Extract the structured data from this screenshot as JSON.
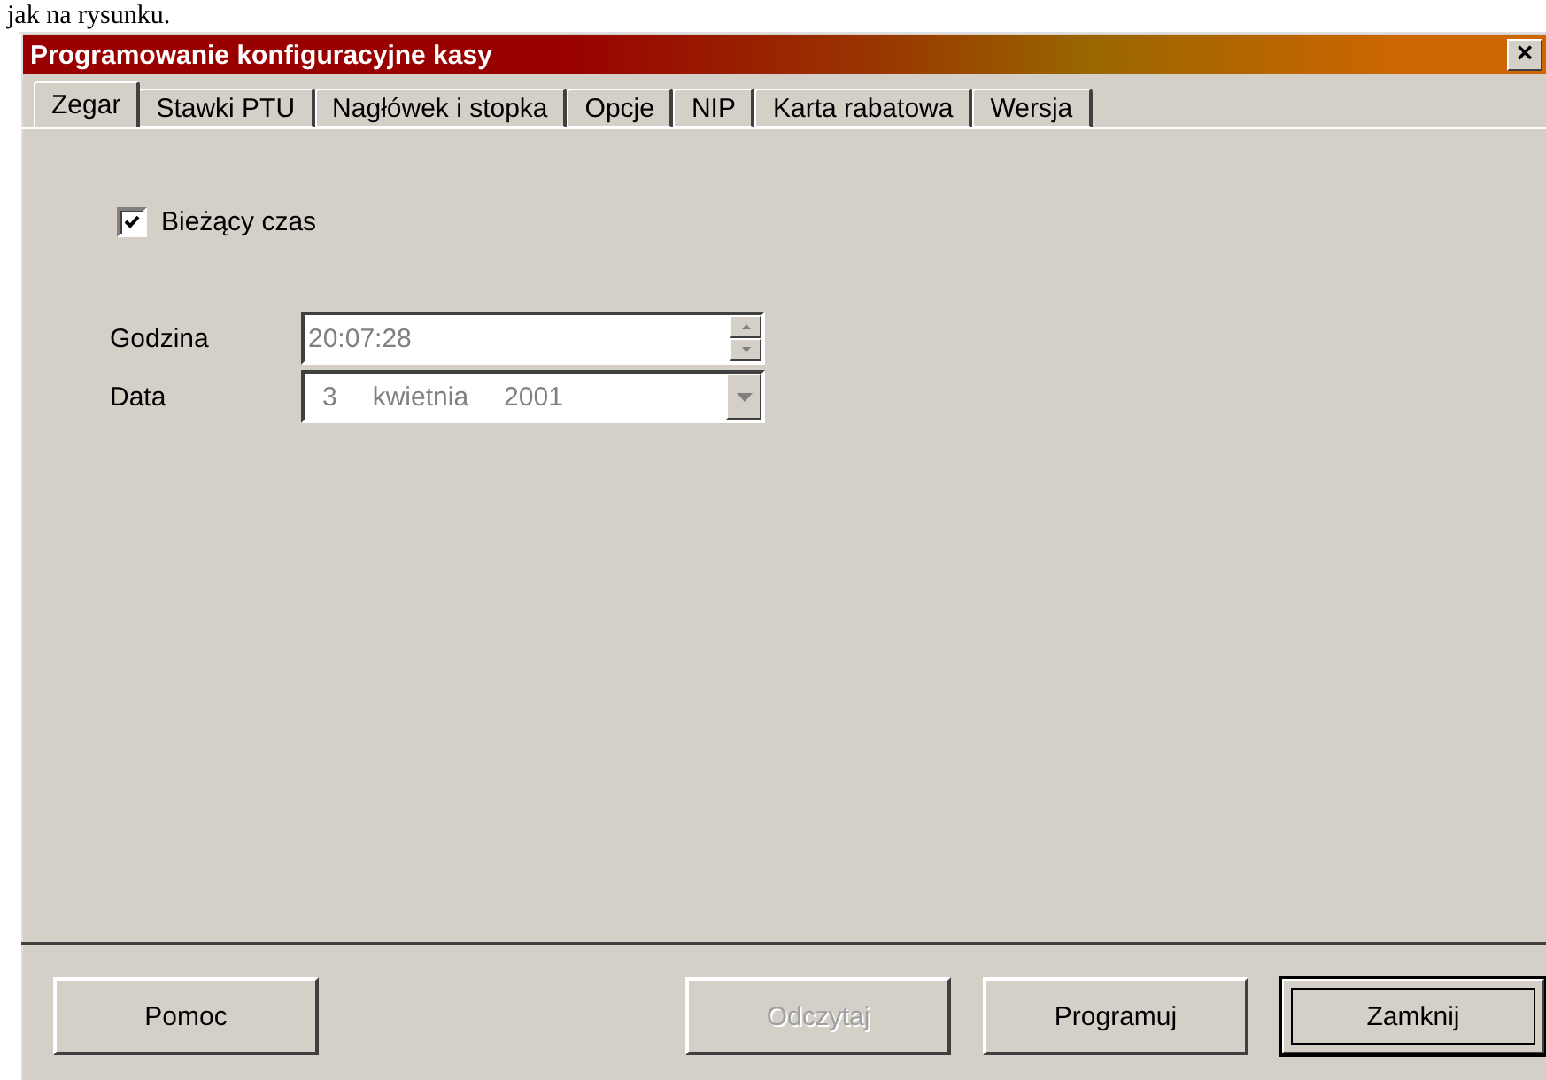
{
  "document_text": "jak na rysunku.",
  "window": {
    "title": "Programowanie konfiguracyjne kasy",
    "close": "×"
  },
  "tabs": [
    {
      "label": "Zegar",
      "selected": true
    },
    {
      "label": "Stawki PTU",
      "selected": false
    },
    {
      "label": "Nagłówek i stopka",
      "selected": false
    },
    {
      "label": "Opcje",
      "selected": false
    },
    {
      "label": "NIP",
      "selected": false
    },
    {
      "label": "Karta rabatowa",
      "selected": false
    },
    {
      "label": "Wersja",
      "selected": false
    }
  ],
  "current_time": {
    "label": "Bieżący czas",
    "checked": true
  },
  "fields": [
    {
      "kind": "spin",
      "label": "Godzina",
      "value": "20:07:28",
      "disabled": true
    },
    {
      "kind": "date",
      "label": "Data",
      "parts": [
        "3",
        "kwietnia",
        "2001"
      ],
      "disabled": true
    }
  ],
  "buttons": [
    {
      "label": "Pomoc",
      "disabled": false,
      "default": false
    },
    {
      "label": "Odczytaj",
      "disabled": true,
      "default": false
    },
    {
      "label": "Programuj",
      "disabled": false,
      "default": false
    },
    {
      "label": "Zamknij",
      "disabled": false,
      "default": true
    }
  ]
}
